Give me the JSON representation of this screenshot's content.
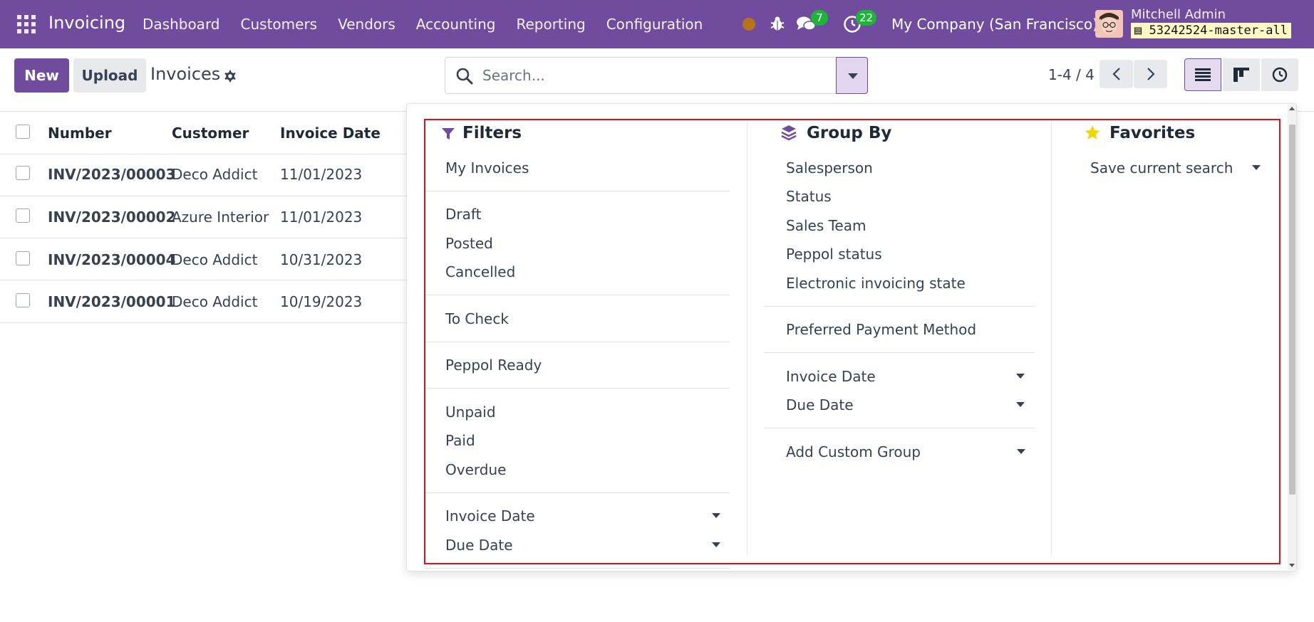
{
  "navbar": {
    "app_name": "Invoicing",
    "menu": [
      "Dashboard",
      "Customers",
      "Vendors",
      "Accounting",
      "Reporting",
      "Configuration"
    ],
    "chat_count": "7",
    "activity_count": "22",
    "company": "My Company (San Francisco)",
    "user_name": "Mitchell Admin",
    "database": "53242524-master-all",
    "colors": {
      "brand": "#714b9d",
      "badge": "#1eb43a",
      "status_dot": "#b7731a"
    }
  },
  "control": {
    "new_label": "New",
    "upload_label": "Upload",
    "title": "Invoices",
    "search_placeholder": "Search...",
    "pager": "1-4 / 4"
  },
  "list": {
    "headers": [
      "Number",
      "Customer",
      "Invoice Date"
    ],
    "rows": [
      {
        "number": "INV/2023/00003",
        "customer": "Deco Addict",
        "date": "11/01/2023"
      },
      {
        "number": "INV/2023/00002",
        "customer": "Azure Interior",
        "date": "11/01/2023"
      },
      {
        "number": "INV/2023/00004",
        "customer": "Deco Addict",
        "date": "10/31/2023"
      },
      {
        "number": "INV/2023/00001",
        "customer": "Deco Addict",
        "date": "10/19/2023"
      }
    ]
  },
  "dropdown": {
    "filters": {
      "title": "Filters",
      "items": [
        "My Invoices",
        "Draft",
        "Posted",
        "Cancelled",
        "To Check",
        "Peppol Ready",
        "Unpaid",
        "Paid",
        "Overdue",
        "Invoice Date",
        "Due Date"
      ]
    },
    "groupby": {
      "title": "Group By",
      "items": [
        "Salesperson",
        "Status",
        "Sales Team",
        "Peppol status",
        "Electronic invoicing state",
        "Preferred Payment Method",
        "Invoice Date",
        "Due Date",
        "Add Custom Group"
      ]
    },
    "favorites": {
      "title": "Favorites",
      "items": [
        "Save current search"
      ]
    }
  }
}
